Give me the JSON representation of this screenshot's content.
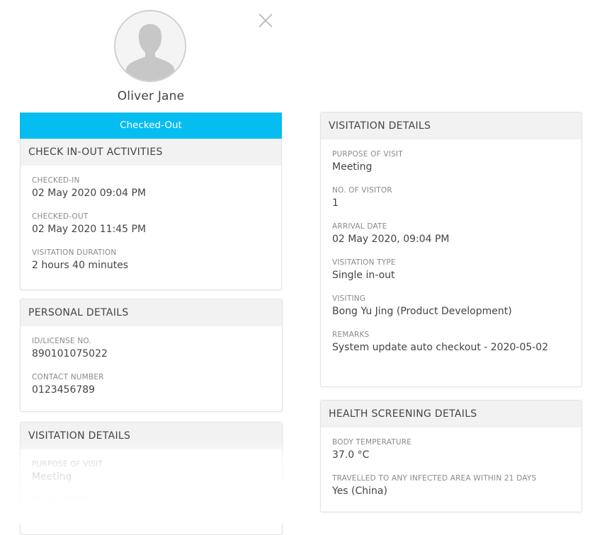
{
  "visitor": {
    "name": "Oliver Jane",
    "status": "Checked-Out"
  },
  "check_activities": {
    "title": "CHECK IN-OUT ACTIVITIES",
    "fields": [
      {
        "label": "CHECKED-IN",
        "value": "02 May 2020 09:04 PM"
      },
      {
        "label": "CHECKED-OUT",
        "value": "02 May 2020 11:45 PM"
      },
      {
        "label": "VISITATION DURATION",
        "value": "2 hours 40 minutes"
      }
    ]
  },
  "personal_details": {
    "title": "PERSONAL DETAILS",
    "fields": [
      {
        "label": "ID/LICENSE NO.",
        "value": "890101075022"
      },
      {
        "label": "CONTACT NUMBER",
        "value": "0123456789"
      }
    ]
  },
  "visitation_details_left": {
    "title": "VISITATION DETAILS",
    "fields": [
      {
        "label": "PURPOSE OF VISIT",
        "value": "Meeting"
      },
      {
        "label": "NO. OF VISITOR",
        "value": ""
      }
    ]
  },
  "visitation_details": {
    "title": "VISITATION DETAILS",
    "fields": [
      {
        "label": "PURPOSE OF VISIT",
        "value": "Meeting"
      },
      {
        "label": "NO. OF VISITOR",
        "value": "1"
      },
      {
        "label": "ARRIVAL DATE",
        "value": "02 May 2020, 09:04 PM"
      },
      {
        "label": "VISITATION TYPE",
        "value": "Single in-out"
      },
      {
        "label": "VISITING",
        "value": "Bong Yu Jing (Product Development)"
      },
      {
        "label": "REMARKS",
        "value": "System update auto checkout - 2020-05-02"
      }
    ]
  },
  "health_screening": {
    "title": "HEALTH SCREENING DETAILS",
    "fields": [
      {
        "label": "BODY TEMPERATURE",
        "value": "37.0 °C"
      },
      {
        "label": "TRAVELLED TO ANY INFECTED AREA WITHIN 21 DAYS",
        "value": "Yes (China)"
      }
    ]
  },
  "icons": {
    "avatar": "person-silhouette-icon",
    "close": "close-icon"
  },
  "colors": {
    "status_bg": "#05bdf0",
    "header_bg": "#f2f2f2"
  }
}
